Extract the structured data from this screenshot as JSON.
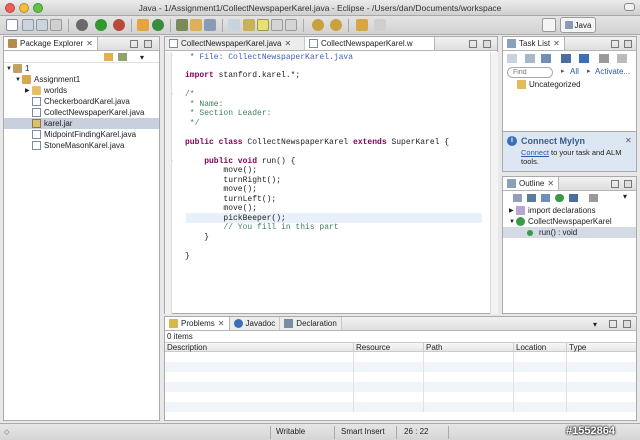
{
  "window": {
    "title": "Java - 1/Assignment1/CollectNewspaperKarel.java - Eclipse - /Users/dan/Documents/workspace"
  },
  "perspective": {
    "label": "Java"
  },
  "package_explorer": {
    "tab_label": "Package Explorer",
    "tree": [
      {
        "label": "1"
      },
      {
        "label": "Assignment1"
      },
      {
        "label": "worlds"
      },
      {
        "label": "CheckerboardKarel.java"
      },
      {
        "label": "CollectNewspaperKarel.java"
      },
      {
        "label": "karel.jar"
      },
      {
        "label": "MidpointFindingKarel.java"
      },
      {
        "label": "StoneMasonKarel.java"
      }
    ]
  },
  "editor": {
    "tabs": [
      {
        "label": "CollectNewspaperKarel.java"
      },
      {
        "label": "CollectNewspaperKarel.w"
      }
    ],
    "lines": [
      " * File: CollectNewspaperKarel.java",
      "",
      "import stanford.karel.*;",
      "",
      "/*",
      " * Name:",
      " * Section Leader:",
      " */",
      "",
      "public class CollectNewspaperKarel extends SuperKarel {",
      "",
      "    public void run() {",
      "        move();",
      "        turnRight();",
      "        move();",
      "        turnLeft();",
      "        move();",
      "        pickBeeper();",
      "        // You fill in this part",
      "    }",
      "",
      "}"
    ]
  },
  "task_list": {
    "tab_label": "Task List",
    "find_placeholder": "Find",
    "all_label": "All",
    "activate_label": "Activate...",
    "category": "Uncategorized"
  },
  "mylyn": {
    "title": "Connect Mylyn",
    "link": "Connect",
    "text": " to your task and ALM",
    "text2": "tools."
  },
  "outline": {
    "tab_label": "Outline",
    "items": [
      {
        "label": "import declarations"
      },
      {
        "label": "CollectNewspaperKarel"
      },
      {
        "label": "run() : void"
      }
    ]
  },
  "problems": {
    "tabs": [
      {
        "label": "Problems"
      },
      {
        "label": "Javadoc"
      },
      {
        "label": "Declaration"
      }
    ],
    "count": "0 items",
    "columns": [
      "Description",
      "Resource",
      "Path",
      "Location",
      "Type"
    ]
  },
  "status": {
    "writable": "Writable",
    "insert_mode": "Smart Insert",
    "position": "26 : 22"
  },
  "watermark": "#1552864"
}
